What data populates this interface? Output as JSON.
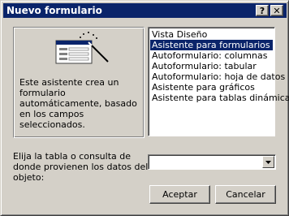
{
  "window": {
    "title": "Nuevo formulario",
    "help_glyph": "?",
    "close_glyph": "✕"
  },
  "description": "Este asistente crea un formulario automáticamente, basado en los campos seleccionados.",
  "views": [
    {
      "label": "Vista Diseño",
      "selected": false
    },
    {
      "label": "Asistente para formularios",
      "selected": true
    },
    {
      "label": "Autoformulario: columnas",
      "selected": false
    },
    {
      "label": "Autoformulario: tabular",
      "selected": false
    },
    {
      "label": "Autoformulario: hoja de datos",
      "selected": false
    },
    {
      "label": "Asistente para gráficos",
      "selected": false
    },
    {
      "label": "Asistente para tablas dinámicas",
      "selected": false
    }
  ],
  "source_prompt": "Elija la tabla o consulta de donde provienen los datos del objeto:",
  "source_value": "",
  "buttons": {
    "ok": "Aceptar",
    "cancel": "Cancelar"
  },
  "icons": {
    "wizard": "form-wizard-icon",
    "dropdown": "chevron-down-icon"
  }
}
